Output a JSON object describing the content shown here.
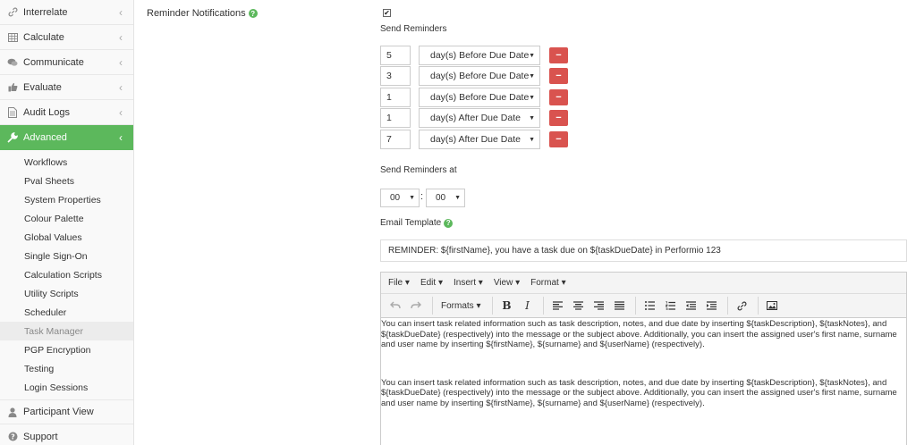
{
  "sidebar": {
    "top_items": [
      {
        "label": "Interrelate"
      },
      {
        "label": "Calculate"
      },
      {
        "label": "Communicate"
      },
      {
        "label": "Evaluate"
      },
      {
        "label": "Audit Logs"
      }
    ],
    "advanced": {
      "label": "Advanced"
    },
    "sub_items": [
      {
        "label": "Workflows"
      },
      {
        "label": "Pval Sheets"
      },
      {
        "label": "System Properties"
      },
      {
        "label": "Colour Palette"
      },
      {
        "label": "Global Values"
      },
      {
        "label": "Single Sign-On"
      },
      {
        "label": "Calculation Scripts"
      },
      {
        "label": "Utility Scripts"
      },
      {
        "label": "Scheduler"
      },
      {
        "label": "Task Manager"
      },
      {
        "label": "PGP Encryption"
      },
      {
        "label": "Testing"
      },
      {
        "label": "Login Sessions"
      }
    ],
    "bottom_items": [
      {
        "label": "Participant View"
      },
      {
        "label": "Support"
      }
    ],
    "colors": {
      "active": "#5cb85c"
    }
  },
  "main": {
    "reminder_notifications_label": "Reminder Notifications",
    "send_reminders_label": "Send Reminders",
    "reminders": [
      {
        "value": "5",
        "option": "day(s) Before Due Date"
      },
      {
        "value": "3",
        "option": "day(s) Before Due Date"
      },
      {
        "value": "1",
        "option": "day(s) Before Due Date"
      },
      {
        "value": "1",
        "option": "day(s) After Due Date"
      },
      {
        "value": "7",
        "option": "day(s) After Due Date"
      }
    ],
    "send_reminders_at_label": "Send Reminders at",
    "hour": "00",
    "minute": "00",
    "email_template_label": "Email Template",
    "subject": "REMINDER: ${firstName}, you have a task due on ${taskDueDate} in Performio 123",
    "editor": {
      "menus": [
        {
          "label": "File"
        },
        {
          "label": "Edit"
        },
        {
          "label": "Insert"
        },
        {
          "label": "View"
        },
        {
          "label": "Format"
        }
      ],
      "formats_label": "Formats",
      "paragraphs": [
        "You can insert task related information such as task description, notes, and due date by inserting ${taskDescription}, ${taskNotes}, and ${taskDueDate} (respectively) into the message or the subject above. Additionally, you can insert the assigned user's first name, surname and user name by inserting ${firstName}, ${surname} and ${userName} (respectively).",
        "You can insert task related information such as task description, notes, and due date by inserting ${taskDescription}, ${taskNotes}, and ${taskDueDate} (respectively) into the message or the subject above. Additionally, you can insert the assigned user's first name, surname and user name by inserting ${firstName}, ${surname} and ${userName} (respectively)."
      ]
    },
    "colors": {
      "delete": "#d9534f",
      "help": "#5cb85c"
    }
  }
}
